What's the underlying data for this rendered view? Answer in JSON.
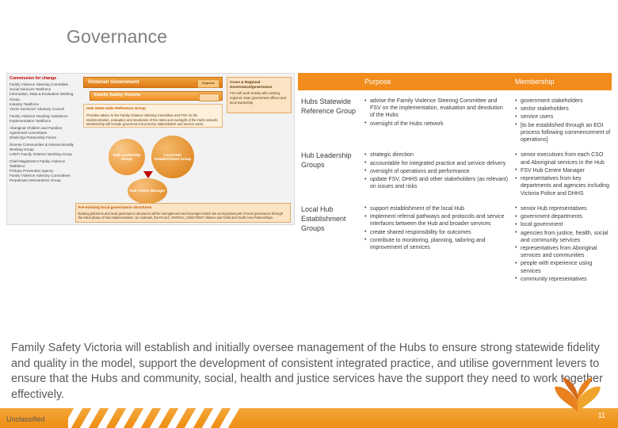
{
  "slide": {
    "title": "Governance",
    "page_number": "11",
    "classification": "Unclassified"
  },
  "diagram": {
    "left_column": [
      {
        "heading": "Commission for change",
        "lines": [
          "Family Violence Steering Committee",
          "Social Services Taskforce",
          "Information, Data & Evaluation Working Group",
          "Industry Taskforce",
          "Victim Survivors' Advisory Council"
        ]
      },
      {
        "heading": "",
        "lines": [
          "Family Violence Housing Assistance Implementation Taskforce"
        ]
      },
      {
        "heading": "",
        "lines": [
          "Aboriginal Children and Families Agreement committees",
          "Dhelk Dja Partnership Forum"
        ]
      },
      {
        "heading": "",
        "lines": [
          "Diverse Communities & Intersectionality Working Group",
          "LGBTI Family Violence Working Group"
        ]
      },
      {
        "heading": "",
        "lines": [
          "Chief Magistrate's Family Violence Taskforce",
          "Primary Prevention Agency",
          "Family Violence Advisory Committees",
          "Perpetrator Interventions Group"
        ]
      }
    ],
    "vic_government_label": "Victorian Government",
    "vic_government_tag": "Regional",
    "fsv_label": "Family Safety Victoria",
    "cross_regional": {
      "heading": "Cross & Regional Governance/governance",
      "body": "FSV will work closely with existing regional, state government offices and local leadership"
    },
    "reference_group": {
      "heading": "Hub State-wide Reference Group",
      "body": "Provides advice to the Family Violence Steering Committee and FSV on the implementation, evaluation and devolution of the Hubs and oversight of the Hubs network. Membership will include government and sector stakeholders and service users."
    },
    "circles": [
      {
        "label": "Hub Leadership Group"
      },
      {
        "label": "Local Hub Establishment Group"
      },
      {
        "label": "Hub Centre Manager"
      }
    ],
    "preexisting": {
      "heading": "Pre-existing local governance structures",
      "body": "Existing platforms and local governance structures will be strengthened and leveraged which are an important part of local governance through the initial phase of hub implementation, for example, the RAJAC, RAPACs, Child FIRST Alliance and Child and Youth Area Partnerships."
    }
  },
  "table": {
    "headers": [
      "",
      "Purpose",
      "Membership"
    ],
    "rows": [
      {
        "label": "Hubs Statewide Reference Group",
        "purpose": [
          "advise the Family Violence Steering Committee and FSV on the implementation, evaluation and devolution of the Hubs",
          "oversight of the Hubs network"
        ],
        "membership": [
          "government stakeholders",
          "sector stakeholders",
          "service users",
          "[to be established through an EOI process following commencement of operations]"
        ]
      },
      {
        "label": "Hub Leadership Groups",
        "purpose": [
          "strategic direction",
          "accountable for integrated practice and service delivery",
          "oversight of operations and performance",
          "update FSV, DHHS and other stakeholders (as relevant) on issues and risks"
        ],
        "membership": [
          "senior executives from each CSO and Aboriginal services in the Hub",
          "FSV Hub Centre Manager",
          "representatives from key departments and agencies including Victoria Police and DHHS"
        ]
      },
      {
        "label": "Local Hub Establishment Groups",
        "purpose": [
          "support establishment of the local Hub",
          "implement referral pathways and protocols and service interfaces between the Hub and broader services",
          "create shared responsibility for outcomes",
          "contribute to monitoring, planning, tailoring and improvement of services"
        ],
        "membership": [
          "senior Hub representatives",
          "government departments",
          "local government",
          "agencies from justice, health, social and community services",
          "representatives from Aboriginal services and communities",
          "people with experience using services",
          "community representatives"
        ]
      }
    ]
  },
  "footer_paragraph": "Family Safety Victoria will establish and initially oversee management of the Hubs to ensure strong statewide fidelity and quality in the model, support the development of consistent integrated practice, and utilise government levers to ensure that the Hubs and community, social, health and justice services have the support they need to work together effectively."
}
